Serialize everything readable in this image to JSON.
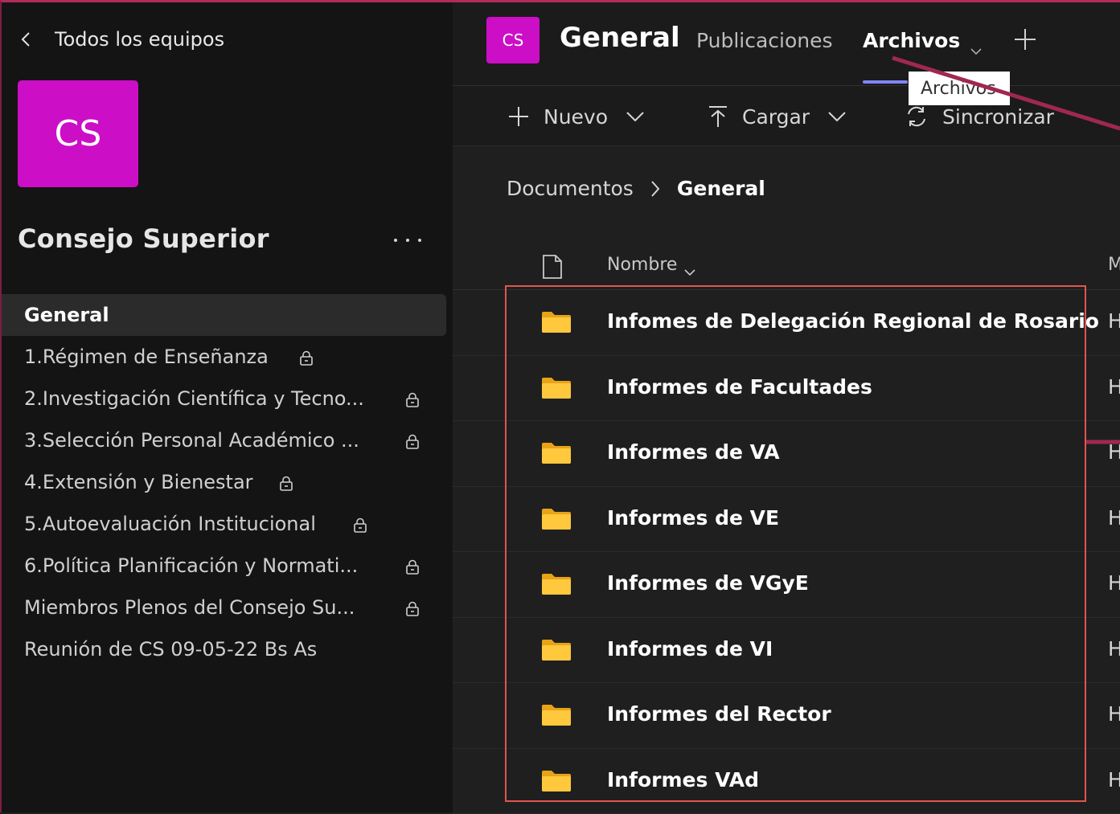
{
  "sidebar": {
    "back_label": "Todos los equipos",
    "team_initials": "CS",
    "team_name": "Consejo Superior",
    "channels": [
      {
        "label": "General",
        "active": true,
        "locked": false
      },
      {
        "label": "1.Régimen de Enseñanza",
        "locked": true
      },
      {
        "label": "2.Investigación Científica y Tecno...",
        "locked": true
      },
      {
        "label": "3.Selección Personal Académico ...",
        "locked": true
      },
      {
        "label": "4.Extensión y Bienestar",
        "locked": true
      },
      {
        "label": "5.Autoevaluación Institucional",
        "locked": true
      },
      {
        "label": "6.Política Planificación y Normati...",
        "locked": true
      },
      {
        "label": "Miembros Plenos del Consejo Su...",
        "locked": true
      },
      {
        "label": "Reunión de CS 09-05-22 Bs As",
        "locked": false
      }
    ]
  },
  "header": {
    "team_initials": "CS",
    "channel_title": "General",
    "tabs": {
      "posts": "Publicaciones",
      "files": "Archivos"
    },
    "tooltip": "Archivos"
  },
  "commands": {
    "new": "Nuevo",
    "upload": "Cargar",
    "sync": "Sincronizar"
  },
  "breadcrumb": {
    "root": "Documentos",
    "current": "General"
  },
  "columns": {
    "name": "Nombre",
    "modified": "M"
  },
  "files": [
    {
      "name": "Infomes de Delegación Regional de Rosario",
      "mod": "H"
    },
    {
      "name": "Informes de Facultades",
      "mod": "H"
    },
    {
      "name": "Informes de VA",
      "mod": "H"
    },
    {
      "name": "Informes de VE",
      "mod": "H"
    },
    {
      "name": "Informes de VGyE",
      "mod": "H"
    },
    {
      "name": "Informes de VI",
      "mod": "H"
    },
    {
      "name": "Informes del Rector",
      "mod": "H"
    },
    {
      "name": "Informes VAd",
      "mod": "H"
    }
  ],
  "colors": {
    "accent": "#7f85f5",
    "team_color": "#cc0ec7",
    "folder": "#ffc83d",
    "highlight": "#e0564a",
    "arrow": "#a0284f"
  }
}
